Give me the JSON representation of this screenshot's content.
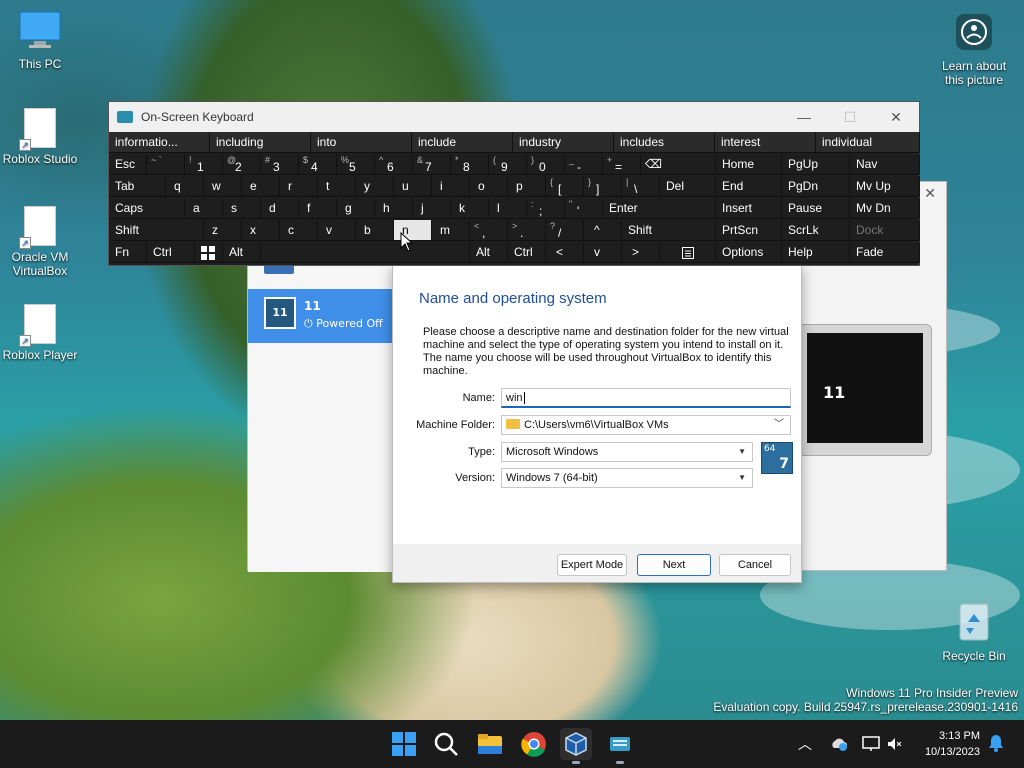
{
  "desktop": {
    "icons": [
      {
        "label": "This PC"
      },
      {
        "label": "Roblox Studio"
      },
      {
        "label": "Oracle VM VirtualBox"
      },
      {
        "label": "Roblox Player"
      }
    ],
    "learn_label": "Learn about this picture",
    "recycle_label": "Recycle Bin",
    "watermark_line1": "Windows 11 Pro Insider Preview",
    "watermark_line2": "Evaluation copy. Build 25947.rs_prerelease.230901-1416"
  },
  "osk": {
    "title": "On-Screen Keyboard",
    "predictions": [
      "informatio...",
      "including",
      "into",
      "include",
      "industry",
      "includes",
      "interest",
      "individual"
    ],
    "row1": {
      "esc": "Esc",
      "keys": [
        {
          "sub": "~ `",
          "main": ""
        },
        {
          "sub": "!",
          "main": "1"
        },
        {
          "sub": "@",
          "main": "2"
        },
        {
          "sub": "#",
          "main": "3"
        },
        {
          "sub": "$",
          "main": "4"
        },
        {
          "sub": "%",
          "main": "5"
        },
        {
          "sub": "^",
          "main": "6"
        },
        {
          "sub": "&",
          "main": "7"
        },
        {
          "sub": "*",
          "main": "8"
        },
        {
          "sub": "(",
          "main": "9"
        },
        {
          "sub": ")",
          "main": "0"
        },
        {
          "sub": "_",
          "main": "-"
        },
        {
          "sub": "+",
          "main": "="
        }
      ],
      "backspace": "⌫"
    },
    "row2": {
      "tab": "Tab",
      "keys": [
        "q",
        "w",
        "e",
        "r",
        "t",
        "y",
        "u",
        "i",
        "o",
        "p"
      ],
      "brackets": [
        {
          "sub": "{",
          "main": "["
        },
        {
          "sub": "}",
          "main": "]"
        },
        {
          "sub": "|",
          "main": "\\"
        }
      ],
      "del": "Del"
    },
    "row3": {
      "caps": "Caps",
      "keys": [
        "a",
        "s",
        "d",
        "f",
        "g",
        "h",
        "j",
        "k",
        "l"
      ],
      "punct": [
        {
          "sub": ":",
          "main": ";"
        },
        {
          "sub": "\"",
          "main": "'"
        }
      ],
      "enter": "Enter"
    },
    "row4": {
      "shift": "Shift",
      "keys": [
        "z",
        "x",
        "c",
        "v",
        "b",
        "n",
        "m"
      ],
      "punct": [
        {
          "sub": "<",
          "main": ","
        },
        {
          "sub": ">",
          "main": "."
        },
        {
          "sub": "?",
          "main": "/"
        }
      ],
      "up": "^",
      "shift_right": "Shift"
    },
    "row5": {
      "fn": "Fn",
      "ctrl": "Ctrl",
      "alt": "Alt",
      "alt_right": "Alt",
      "ctrl_right": "Ctrl",
      "left": "<",
      "down": "v",
      "right": ">"
    },
    "nav": {
      "row1": [
        "Home",
        "PgUp",
        "Nav"
      ],
      "row2": [
        "End",
        "PgDn",
        "Mv Up"
      ],
      "row3": [
        "Insert",
        "Pause",
        "Mv Dn"
      ],
      "row4": [
        "PrtScn",
        "ScrLk",
        "Dock"
      ],
      "row5": [
        "Options",
        "Help",
        "Fade"
      ]
    }
  },
  "vbox": {
    "vm_name": "11",
    "vm_status": "Powered Off",
    "vm_badge": "11",
    "preview_label": "11"
  },
  "dialog": {
    "heading": "Name and operating system",
    "description": "Please choose a descriptive name and destination folder for the new virtual machine and select the type of operating system you intend to install on it. The name you choose will be used throughout VirtualBox to identify this machine.",
    "name_label": "Name:",
    "name_value": "win",
    "folder_label": "Machine Folder:",
    "folder_value": "C:\\Users\\vm6\\VirtualBox VMs",
    "type_label": "Type:",
    "type_value": "Microsoft Windows",
    "version_label": "Version:",
    "version_value": "Windows 7 (64-bit)",
    "badge_64": "64",
    "badge_ver": "7",
    "expert_label": "Expert Mode",
    "next_label": "Next",
    "cancel_label": "Cancel"
  },
  "taskbar": {
    "time": "3:13 PM",
    "date": "10/13/2023"
  }
}
